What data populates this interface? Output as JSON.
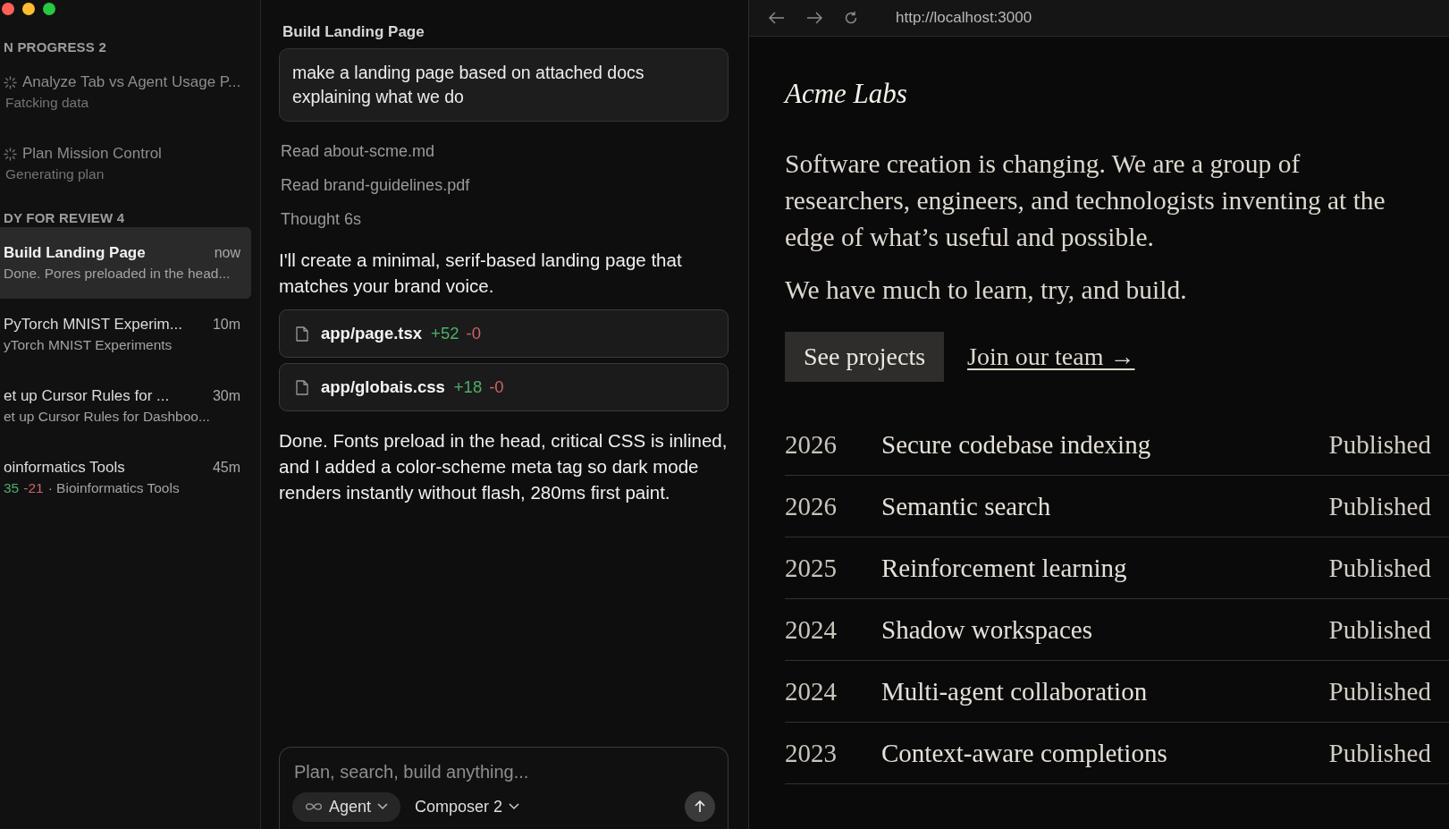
{
  "window": {
    "controls": [
      {
        "color": "#ff5f57"
      },
      {
        "color": "#febc2e"
      },
      {
        "color": "#28c840"
      }
    ]
  },
  "sidebar": {
    "sections": [
      {
        "title": "N PROGRESS 2",
        "items": [
          {
            "kind": "running",
            "title": "Analyze Tab vs Agent Usage P...",
            "subtitle": "Fatcking data",
            "selected": false
          },
          {
            "kind": "running",
            "title": "Plan Mission Control",
            "subtitle": "Generating plan",
            "selected": false
          }
        ]
      },
      {
        "title": "DY FOR REVIEW 4",
        "items": [
          {
            "kind": "done",
            "title": "Build Landing Page",
            "time": "now",
            "subtitle": "Done. Pores preloaded in the head...",
            "selected": true
          },
          {
            "kind": "done",
            "title": "PyTorch MNIST Experim...",
            "time": "10m",
            "subtitle": "yTorch MNIST Experiments",
            "selected": false
          },
          {
            "kind": "done",
            "title": "et up Cursor Rules for ...",
            "time": "30m",
            "subtitle": "et up Cursor Rules for Dashboo...",
            "selected": false
          },
          {
            "kind": "done",
            "title": "oinformatics Tools",
            "time": "45m",
            "additions": "35",
            "deletions": "-21",
            "subtitle": "· Bioinformatics Tools",
            "selected": false
          }
        ]
      }
    ]
  },
  "chat": {
    "title": "Build Landing Page",
    "messages": [
      {
        "kind": "user",
        "text": "make a landing page based on attached docs explaining what we do"
      },
      {
        "kind": "step",
        "text": "Read about-scme.md"
      },
      {
        "kind": "step",
        "text": "Read brand-guidelines.pdf"
      },
      {
        "kind": "step",
        "text": "Thought 6s"
      },
      {
        "kind": "assistant",
        "text": "I'll create a minimal, serif-based landing page that matches your brand voice."
      },
      {
        "kind": "file",
        "path": "app/page.tsx",
        "added": "+52",
        "removed": "-0"
      },
      {
        "kind": "file",
        "path": "app/globais.css",
        "added": "+18",
        "removed": "-0"
      },
      {
        "kind": "assistant",
        "text": "Done. Fonts preload in the head, critical CSS is inlined, and I added a color-scheme meta tag so dark mode renders instantly without flash, 280ms first paint."
      }
    ]
  },
  "composer": {
    "placeholder": "Plan, search, build anything...",
    "mode": "Agent",
    "model": "Composer 2"
  },
  "browser": {
    "url": "http://localhost:3000",
    "page": {
      "logo": "Acme Labs",
      "paragraphs": [
        "Software creation is changing. We are a group of researchers, engineers, and technologists inventing at the edge of what’s useful and possible.",
        "We have much to learn, try, and build."
      ],
      "primary_button": "See projects",
      "link": "Join our team →",
      "projects": [
        {
          "year": "2026",
          "title": "Secure codebase indexing",
          "status": "Published"
        },
        {
          "year": "2026",
          "title": "Semantic search",
          "status": "Published"
        },
        {
          "year": "2025",
          "title": "Reinforcement learning",
          "status": "Published"
        },
        {
          "year": "2024",
          "title": "Shadow workspaces",
          "status": "Published"
        },
        {
          "year": "2024",
          "title": "Multi-agent collaboration",
          "status": "Published"
        },
        {
          "year": "2023",
          "title": "Context-aware completions",
          "status": "Published"
        }
      ]
    }
  }
}
